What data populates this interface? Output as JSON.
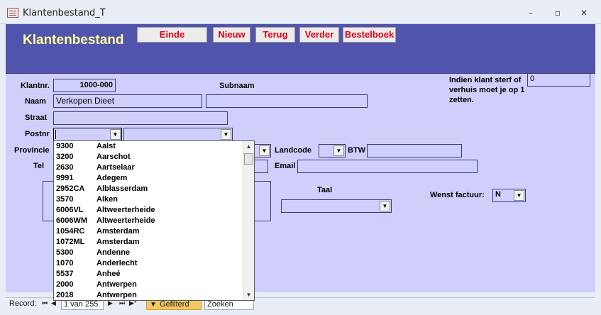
{
  "window": {
    "title": "Klantenbestand_T",
    "minimize": "–",
    "maximize": "▫",
    "close": "✕"
  },
  "header": {
    "title": "Klantenbestand",
    "buttons": {
      "einde": "Einde",
      "nieuw": "Nieuw",
      "terug": "Terug",
      "verder": "Verder",
      "bestelboek": "Bestelboek"
    }
  },
  "form": {
    "klantnr_label": "Klantnr.",
    "klantnr_value": "1000-000",
    "subnaam_label": "Subnaam",
    "subnaam_value": "",
    "naam_label": "Naam",
    "naam_value": "Verkopen Dieet",
    "straat_label": "Straat",
    "straat_value": "",
    "postnr_label": "Postnr",
    "postnr_value": "",
    "provincie_label": "Provincie",
    "tel_label": "Tel",
    "landcode_label": "Landcode",
    "btw_label": "BTW",
    "email_label": "Email",
    "taal_label": "Taal",
    "wenst_factuur_label": "Wenst factuur:",
    "wenst_factuur_value": "N",
    "indien_label": "Indien klant sterf of verhuis moet je op 1 zetten.",
    "indien_value": "0"
  },
  "dropdown_list": [
    {
      "code": "9300",
      "city": "Aalst"
    },
    {
      "code": "3200",
      "city": "Aarschot"
    },
    {
      "code": "2630",
      "city": "Aartselaar"
    },
    {
      "code": "9991",
      "city": "Adegem"
    },
    {
      "code": "2952CA",
      "city": "Alblasserdam"
    },
    {
      "code": "3570",
      "city": "Alken"
    },
    {
      "code": "6006VL",
      "city": "Altweerterheide"
    },
    {
      "code": "6006WM",
      "city": "Altweerterheide"
    },
    {
      "code": "1054RC",
      "city": "Amsterdam"
    },
    {
      "code": "1072ML",
      "city": "Amsterdam"
    },
    {
      "code": "5300",
      "city": "Andenne"
    },
    {
      "code": "1070",
      "city": "Anderlecht"
    },
    {
      "code": "5537",
      "city": "Anheé"
    },
    {
      "code": "2000",
      "city": "Antwerpen"
    },
    {
      "code": "2018",
      "city": "Antwerpen"
    }
  ],
  "navbar": {
    "record_label": "Record:",
    "record_value": "1 van 255",
    "filter_label": "Gefilterd",
    "search_label": "Zoeken"
  }
}
